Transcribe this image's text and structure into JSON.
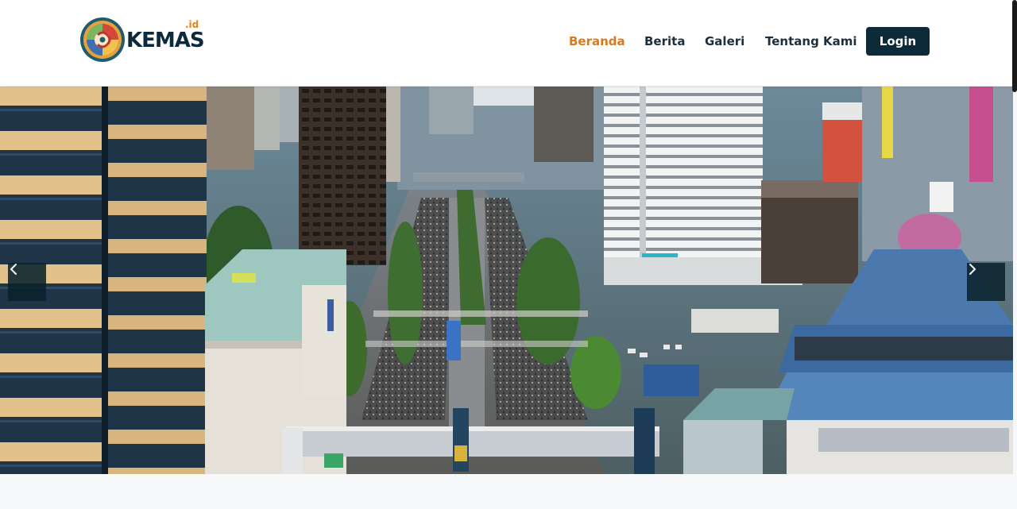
{
  "brand": {
    "name": "KEMAS",
    "suffix": ".id"
  },
  "nav": {
    "items": [
      {
        "label": "Beranda",
        "active": true
      },
      {
        "label": "Berita",
        "active": false
      },
      {
        "label": "Galeri",
        "active": false
      },
      {
        "label": "Tentang Kami",
        "active": false
      }
    ],
    "login_label": "Login"
  },
  "hero": {
    "prev_icon": "chevron-left-icon",
    "next_icon": "chevron-right-icon"
  },
  "colors": {
    "accent": "#d9781f",
    "nav_text": "#1c2f3c",
    "button_bg": "#0d2a38",
    "arrow_bg": "#0a222c"
  }
}
